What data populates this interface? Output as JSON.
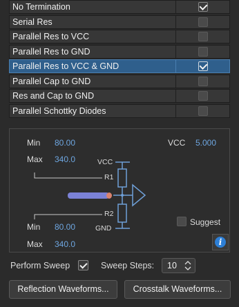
{
  "termination_options": [
    {
      "label": "No Termination",
      "checked": true,
      "selected": false
    },
    {
      "label": "Serial Res",
      "checked": false,
      "selected": false
    },
    {
      "label": "Parallel Res to VCC",
      "checked": false,
      "selected": false
    },
    {
      "label": "Parallel Res to GND",
      "checked": false,
      "selected": false
    },
    {
      "label": "Parallel Res to VCC & GND",
      "checked": true,
      "selected": true
    },
    {
      "label": "Parallel Cap to GND",
      "checked": false,
      "selected": false
    },
    {
      "label": "Res and Cap to GND",
      "checked": false,
      "selected": false
    },
    {
      "label": "Parallel Schottky Diodes",
      "checked": false,
      "selected": false
    }
  ],
  "params": {
    "r1": {
      "min_label": "Min",
      "min": "80.00",
      "max_label": "Max",
      "max": "340.0"
    },
    "r2": {
      "min_label": "Min",
      "min": "80.00",
      "max_label": "Max",
      "max": "340.0"
    },
    "vcc_label": "VCC",
    "vcc_value": "5.000"
  },
  "schematic": {
    "vcc": "VCC",
    "gnd": "GND",
    "r1": "R1",
    "r2": "R2"
  },
  "suggest_label": "Suggest",
  "sweep": {
    "perform_label": "Perform Sweep",
    "checked": true,
    "steps_label": "Sweep Steps:",
    "steps": "10"
  },
  "buttons": {
    "reflection": "Reflection Waveforms...",
    "crosstalk": "Crosstalk Waveforms..."
  },
  "colors": {
    "selected_row": "#2f5f8c",
    "value_text": "#6ea6e0",
    "wire": "#6fa0d8",
    "cable": "#7b82d6",
    "cable_end": "#d9836f"
  }
}
